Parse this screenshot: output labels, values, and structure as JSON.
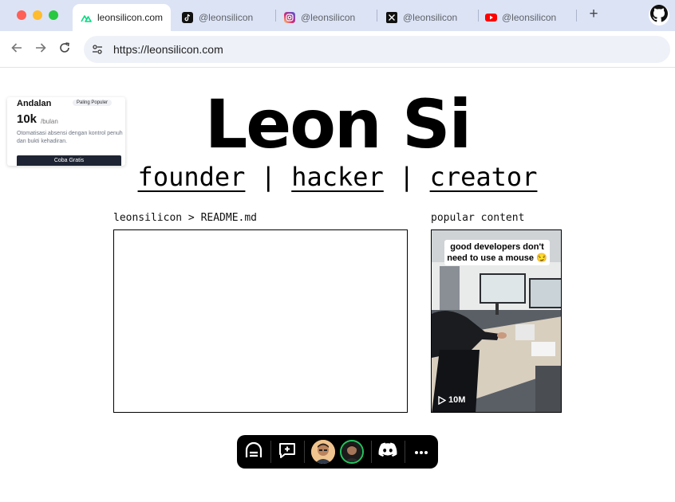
{
  "browser": {
    "tabs": [
      {
        "label": "leonsilicon.com",
        "icon": "nuxt-icon",
        "active": true
      },
      {
        "label": "@leonsilicon",
        "icon": "tiktok-icon",
        "active": false
      },
      {
        "label": "@leonsilicon",
        "icon": "instagram-icon",
        "active": false
      },
      {
        "label": "@leonsilicon",
        "icon": "x-icon",
        "active": false
      },
      {
        "label": "@leonsilicon",
        "icon": "youtube-icon",
        "active": false
      }
    ],
    "new_tab_label": "+",
    "url": "https://leonsilicon.com"
  },
  "ad": {
    "heading": "Andalan",
    "badge": "Paling Populer",
    "price": "10k",
    "period": "/bulan",
    "description": "Otomatisasi absensi dengan kontrol penuh dan bukti kehadiran.",
    "cta": "Coba Gratis"
  },
  "hero": {
    "title": "Leon Si",
    "links": [
      "founder",
      "hacker",
      "creator"
    ],
    "separator": "|"
  },
  "readme": {
    "label": "leonsilicon > README.md"
  },
  "popular": {
    "label": "popular content",
    "caption": "good developers don't need to use a mouse 😏",
    "views": "10M"
  },
  "dock": {
    "items": [
      "app-logo-icon",
      "chat-plus-icon",
      "avatar-1",
      "avatar-2",
      "discord-icon",
      "more-icon"
    ]
  },
  "colors": {
    "tabbar": "#dce3f5",
    "omnibox": "#eef1f8",
    "dock": "#000000",
    "avatar_ring": "#22c55e"
  }
}
